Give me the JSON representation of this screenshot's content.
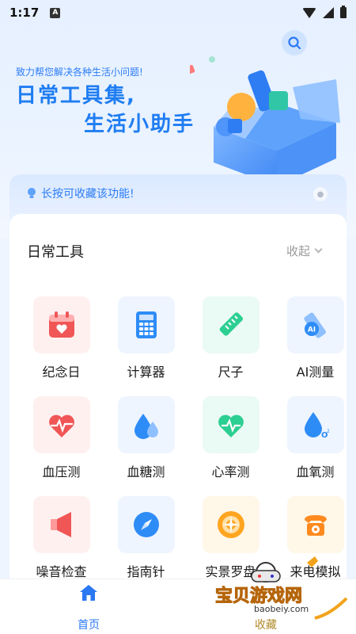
{
  "status": {
    "time": "1:17"
  },
  "hero": {
    "subtitle": "致力帮您解决各种生活小问题!",
    "title_line1": "日常工具集,",
    "title_line2": "生活小助手"
  },
  "tip": {
    "text": "长按可收藏该功能!"
  },
  "section": {
    "title": "日常工具",
    "collapse_label": "收起"
  },
  "tools": [
    {
      "label": "纪念日",
      "icon": "calendar-heart-icon",
      "bg": "#fff0f0",
      "color": "#f05656"
    },
    {
      "label": "计算器",
      "icon": "calculator-icon",
      "bg": "#eef5ff",
      "color": "#2e8cf7"
    },
    {
      "label": "尺子",
      "icon": "ruler-icon",
      "bg": "#eafaf4",
      "color": "#2ccf92"
    },
    {
      "label": "AI测量",
      "icon": "ai-ruler-icon",
      "bg": "#eef5ff",
      "color": "#2e8cf7"
    },
    {
      "label": "血压测",
      "icon": "heart-pulse-icon",
      "bg": "#fff0f0",
      "color": "#f05656"
    },
    {
      "label": "血糖测",
      "icon": "blood-drop-icon",
      "bg": "#eef5ff",
      "color": "#2e8cf7"
    },
    {
      "label": "心率测",
      "icon": "heart-rate-icon",
      "bg": "#eafaf4",
      "color": "#2ccf92"
    },
    {
      "label": "血氧测",
      "icon": "oxygen-drop-icon",
      "bg": "#eef5ff",
      "color": "#2e8cf7"
    },
    {
      "label": "噪音检查",
      "icon": "speaker-icon",
      "bg": "#fff0f0",
      "color": "#f05656"
    },
    {
      "label": "指南针",
      "icon": "compass-icon",
      "bg": "#eef5ff",
      "color": "#2e8cf7"
    },
    {
      "label": "实景罗盘",
      "icon": "luopan-icon",
      "bg": "#fff7e8",
      "color": "#ffa520"
    },
    {
      "label": "来电模拟",
      "icon": "phone-icon",
      "bg": "#fff7e8",
      "color": "#ff8a1f"
    }
  ],
  "nav": {
    "home_label": "首页",
    "fav_label": "收藏"
  },
  "watermark": {
    "title": "宝贝游戏网",
    "url": "baobeiy.com"
  },
  "colors": {
    "accent": "#2a78f2",
    "background": "#eef5ff"
  }
}
